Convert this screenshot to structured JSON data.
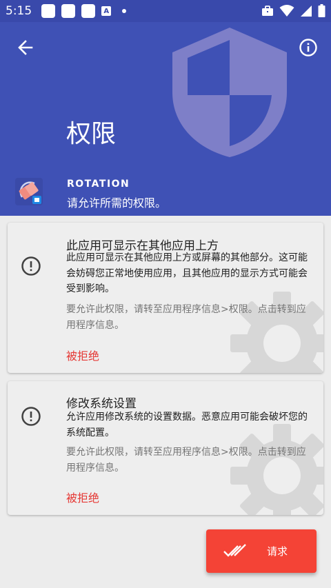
{
  "status_bar": {
    "time": "5:15",
    "notification_a": "A"
  },
  "header": {
    "title": "权限",
    "app_name": "ROTATION",
    "subtitle": "请允许所需的权限。"
  },
  "permissions": [
    {
      "title": "此应用可显示在其他应用上方",
      "description": "此应用可显示在其他应用上方或屏幕的其他部分。这可能会妨碍您正常地使用应用，且其他应用的显示方式可能会受到影响。",
      "hint": "要允许此权限，请转至应用程序信息>权限。点击转到应用程序信息。",
      "status": "被拒绝"
    },
    {
      "title": "修改系统设置",
      "description": "允许应用修改系统的设置数据。恶意应用可能会破坏您的系统配置。",
      "hint": "要允许此权限，请转至应用程序信息>权限。点击转到应用程序信息。",
      "status": "被拒绝"
    }
  ],
  "fab": {
    "label": "请求"
  },
  "colors": {
    "header_bg": "#3f51b5",
    "status_bg": "#3949ab",
    "shield": "#7e7fc8",
    "denied": "#e53935",
    "fab_bg": "#f44336"
  },
  "icons": [
    "back-arrow-icon",
    "info-icon",
    "shield-icon",
    "app-icon",
    "warning-icon",
    "gear-icon",
    "double-check-icon",
    "briefcase-icon",
    "wifi-icon",
    "signal-icon",
    "battery-icon"
  ]
}
